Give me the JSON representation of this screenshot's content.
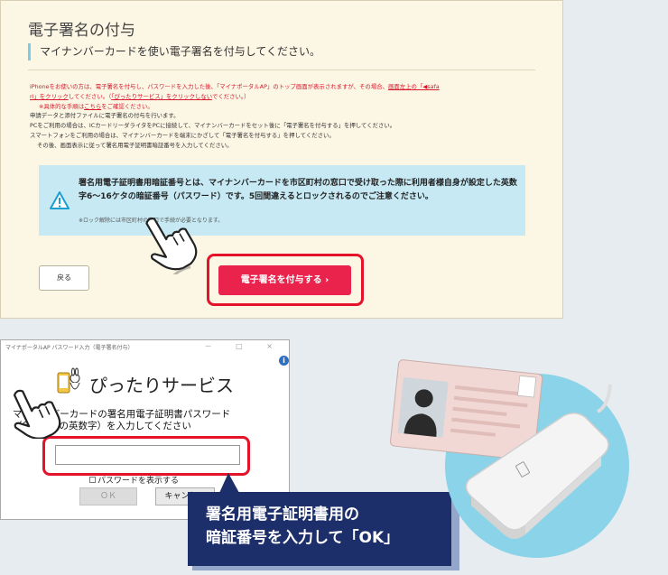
{
  "web": {
    "title": "電子署名の付与",
    "subtitle": "マイナンバーカードを使い電子署名を付与してください。",
    "notes": {
      "l1a": "iPhoneをお使いの方は、電子署名を付与し、パスワードを入力した後、「マイナポータルAP」のトップ画面が表示されますが、その場合、",
      "l1b": "画面左上の「◀safa",
      "l2a": "ri」をクリック",
      "l2b": "してください。（",
      "l2c": "「ぴったりサービス」をクリックしない",
      "l2d": "でください。）",
      "l3a": "※具体的な手順は",
      "l3b": "こちら",
      "l3c": "をご確認ください。",
      "l4": "申請データと添付ファイルに電子署名の付与を行います。",
      "l5": "PCをご利用の場合は、ICカードリーダライタをPCに接続して、マイナンバーカードをセット後に「電子署名を付与する」を押してください。",
      "l6": "スマートフォンをご利用の場合は、マイナンバーカードを端末にかざして「電子署名を付与する」を押してください。",
      "l7": "その後、画面表示に従って署名用電子証明書暗証番号を入力してください。"
    },
    "warning": "署名用電子証明書用暗証番号とは、マイナンバーカードを市区町村の窓口で受け取った際に利用者様自身が設定した英数字6〜16ケタの暗証番号（パスワード）です。5回間違えるとロックされるのでご注意ください。",
    "warning_note": "※ロック解除には市区町村の窓口で手続が必要となります。",
    "back_label": "戻る",
    "sign_label": "電子署名を付与する ›"
  },
  "dialog": {
    "title": "マイナポータルAP パスワード入力（電子署名付与）",
    "controls": "－ □ ×",
    "info_icon": "i",
    "service_name": "ぴったりサービス",
    "prompt": "マイナンバーカードの署名用電子証明書パスワード（6〜16桁の英数字）を入力してください",
    "password_value": "",
    "show_password": "パスワードを表示する",
    "ok_label": "ＯＫ",
    "cancel_label": "キャンセル"
  },
  "callout": {
    "line1": "署名用電子証明書用の",
    "line2": "暗証番号を入力して「OK」"
  },
  "icons": [
    "warning-icon",
    "info-icon",
    "hand-pointer-icon",
    "service-logo-icon",
    "id-card-icon",
    "card-reader-icon"
  ]
}
